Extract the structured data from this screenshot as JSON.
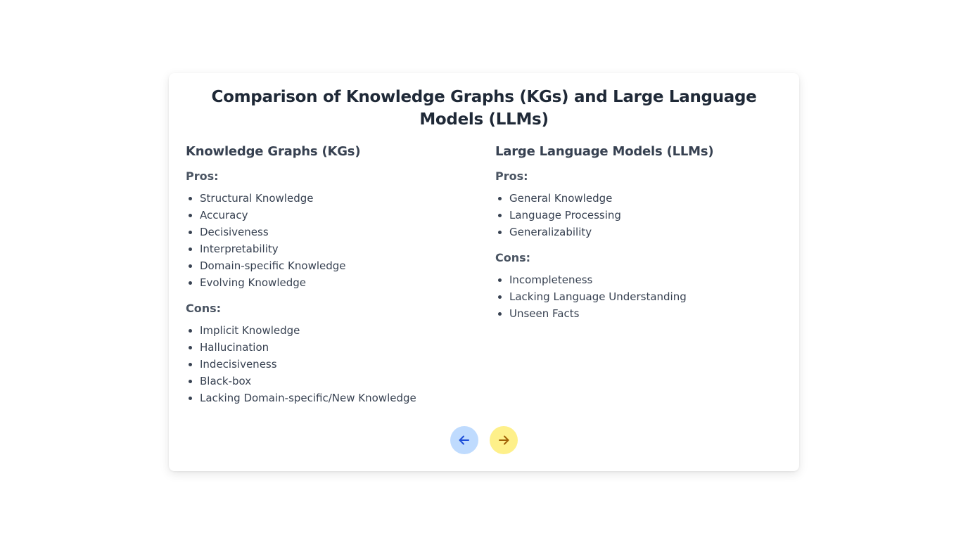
{
  "title": "Comparison of Knowledge Graphs (KGs) and Large Language Models (LLMs)",
  "kgs": {
    "heading": "Knowledge Graphs (KGs)",
    "pros_label": "Pros:",
    "pros": [
      "Structural Knowledge",
      "Accuracy",
      "Decisiveness",
      "Interpretability",
      "Domain-specific Knowledge",
      "Evolving Knowledge"
    ],
    "cons_label": "Cons:",
    "cons": [
      "Implicit Knowledge",
      "Hallucination",
      "Indecisiveness",
      "Black-box",
      "Lacking Domain-specific/New Knowledge"
    ]
  },
  "llms": {
    "heading": "Large Language Models (LLMs)",
    "pros_label": "Pros:",
    "pros": [
      "General Knowledge",
      "Language Processing",
      "Generalizability"
    ],
    "cons_label": "Cons:",
    "cons": [
      "Incompleteness",
      "Lacking Language Understanding",
      "Unseen Facts"
    ]
  },
  "nav": {
    "prev_icon": "arrow-left-icon",
    "next_icon": "arrow-right-icon",
    "prev_color": "#bfdbfe",
    "next_color": "#fef08a",
    "prev_arrow_color": "#1d4ed8",
    "next_arrow_color": "#a16207"
  }
}
